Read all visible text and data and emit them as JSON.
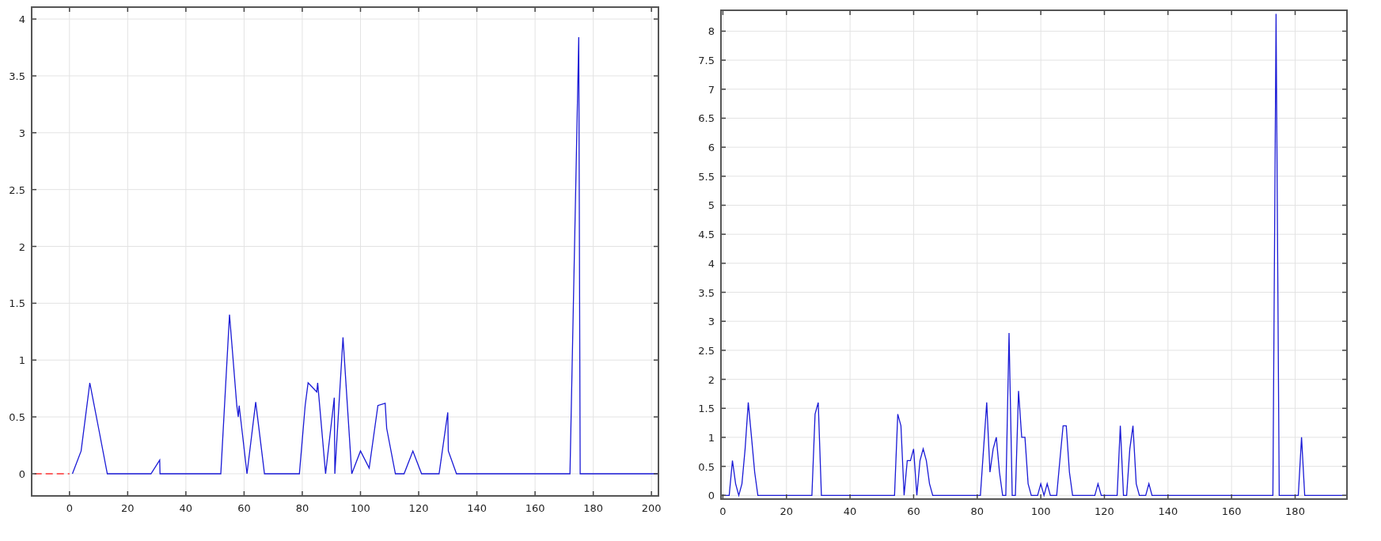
{
  "charts": [
    {
      "chart_data": {
        "type": "line",
        "grid": true,
        "xlim": [
          -13,
          202.4
        ],
        "ylim": [
          -0.195,
          4.105
        ],
        "xticks": [
          0,
          20,
          40,
          60,
          80,
          100,
          120,
          140,
          160,
          180,
          200
        ],
        "yticks": [
          0,
          0.5,
          1,
          1.5,
          2,
          2.5,
          3,
          3.5,
          4
        ],
        "series": [
          {
            "color": "#ff3333",
            "line_style": "dashed",
            "x": [
              -12,
              0
            ],
            "values": [
              0,
              0
            ]
          },
          {
            "color": "#1a1ad6",
            "line_style": "solid",
            "x": [
              1,
              4,
              7,
              10,
              13,
              28,
              31,
              31.1,
              52,
              55,
              57.5,
              58,
              58.3,
              61,
              64,
              67,
              79,
              81,
              82,
              85,
              85.3,
              88,
              91,
              91.2,
              94,
              97,
              100,
              103,
              106,
              108.5,
              109,
              112,
              115,
              118,
              121,
              127,
              130,
              130.2,
              133,
              172,
              175,
              175.5,
              202.4
            ],
            "values": [
              0,
              0.2,
              0.8,
              0.4,
              0,
              0,
              0.12,
              0,
              0,
              1.4,
              0.6,
              0.5,
              0.6,
              0,
              0.63,
              0,
              0,
              0.6,
              0.8,
              0.72,
              0.8,
              0,
              0.67,
              0,
              1.2,
              0,
              0.2,
              0.05,
              0.6,
              0.62,
              0.4,
              0,
              0,
              0.2,
              0,
              0,
              0.54,
              0.2,
              0,
              0,
              3.84,
              0,
              0
            ]
          }
        ]
      }
    },
    {
      "chart_data": {
        "type": "line",
        "grid": true,
        "xlim": [
          -0.6,
          196.3
        ],
        "ylim": [
          -0.064,
          8.36
        ],
        "xticks": [
          0,
          20,
          40,
          60,
          80,
          100,
          120,
          140,
          160,
          180
        ],
        "yticks": [
          0,
          0.5,
          1,
          1.5,
          2,
          2.5,
          3,
          3.5,
          4,
          4.5,
          5,
          5.5,
          6,
          6.5,
          7,
          7.5,
          8
        ],
        "series": [
          {
            "color": "#1a1ad6",
            "line_style": "solid",
            "x": [
              0,
              2,
              3,
              4,
              5,
              6,
              7,
              8,
              9,
              10,
              11,
              28,
              29,
              30,
              31,
              54,
              55,
              56,
              57,
              58,
              59,
              60,
              61,
              62,
              63,
              64,
              65,
              66,
              81,
              82,
              83,
              84,
              85,
              86,
              87,
              88,
              89,
              90,
              91,
              92,
              93,
              94,
              95,
              96,
              97,
              99,
              100,
              101,
              102,
              103,
              105,
              106,
              107,
              108,
              109,
              110,
              117,
              118,
              119,
              124,
              125,
              126,
              127,
              128,
              129,
              130,
              131,
              133,
              134,
              135,
              173,
              174,
              175,
              181,
              182,
              183,
              196.3
            ],
            "values": [
              0,
              0,
              0.6,
              0.2,
              0,
              0.2,
              0.8,
              1.6,
              1,
              0.4,
              0,
              0,
              1.4,
              1.6,
              0,
              0,
              1.4,
              1.2,
              0,
              0.6,
              0.6,
              0.8,
              0,
              0.6,
              0.8,
              0.6,
              0.2,
              0,
              0,
              0.8,
              1.6,
              0.4,
              0.8,
              1,
              0.4,
              0,
              0,
              2.8,
              0,
              0,
              1.8,
              1,
              1,
              0.2,
              0,
              0,
              0.2,
              0,
              0.2,
              0,
              0,
              0.6,
              1.2,
              1.2,
              0.4,
              0,
              0,
              0.2,
              0,
              0,
              1.2,
              0,
              0,
              0.8,
              1.2,
              0.2,
              0,
              0,
              0.2,
              0,
              0,
              8.3,
              0,
              0,
              1,
              0,
              0
            ]
          }
        ]
      }
    }
  ]
}
